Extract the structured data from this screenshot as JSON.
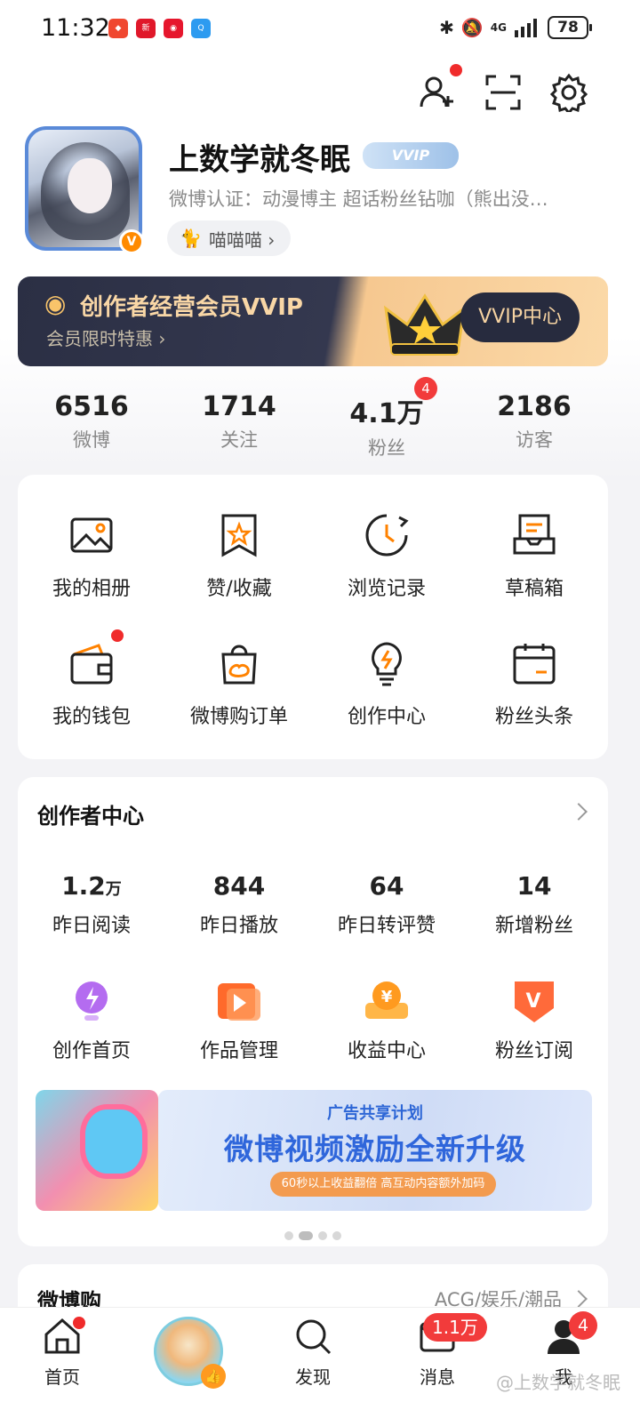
{
  "status_bar": {
    "time": "11:32",
    "network": "4G",
    "battery": "78",
    "app_icons": [
      "app-icon",
      "news-icon",
      "weibo-icon",
      "browser-icon"
    ]
  },
  "header_icons": [
    "add-friend-icon",
    "scan-icon",
    "settings-icon"
  ],
  "profile": {
    "name": "上数学就冬眠",
    "vip_tag": "VVIP",
    "verification": "微博认证：动漫博主 超话粉丝钻咖（熊出没…",
    "group_chip": "喵喵喵 ›"
  },
  "vvip_banner": {
    "title": "创作者经营会员VVIP",
    "subtitle": "会员限时特惠 ›",
    "button": "VVIP中心"
  },
  "stats": [
    {
      "num": "6516",
      "label": "微博"
    },
    {
      "num": "1714",
      "label": "关注"
    },
    {
      "num": "4.1万",
      "label": "粉丝",
      "badge": "4"
    },
    {
      "num": "2186",
      "label": "访客"
    }
  ],
  "grid": [
    {
      "label": "我的相册",
      "icon": "album-icon"
    },
    {
      "label": "赞/收藏",
      "icon": "favorite-icon"
    },
    {
      "label": "浏览记录",
      "icon": "history-icon"
    },
    {
      "label": "草稿箱",
      "icon": "draft-icon"
    },
    {
      "label": "我的钱包",
      "icon": "wallet-icon"
    },
    {
      "label": "微博购订单",
      "icon": "shopping-bag-icon"
    },
    {
      "label": "创作中心",
      "icon": "lightbulb-icon"
    },
    {
      "label": "粉丝头条",
      "icon": "calendar-icon"
    }
  ],
  "creator_center": {
    "title": "创作者中心",
    "stats": [
      {
        "num": "1.2",
        "unit": "万",
        "label": "昨日阅读"
      },
      {
        "num": "844",
        "unit": "",
        "label": "昨日播放"
      },
      {
        "num": "64",
        "unit": "",
        "label": "昨日转评赞"
      },
      {
        "num": "14",
        "unit": "",
        "label": "新增粉丝"
      }
    ],
    "tools": [
      {
        "label": "创作首页",
        "icon": "creation-home-icon"
      },
      {
        "label": "作品管理",
        "icon": "works-icon"
      },
      {
        "label": "收益中心",
        "icon": "income-icon"
      },
      {
        "label": "粉丝订阅",
        "icon": "subscribe-icon"
      }
    ],
    "ad": {
      "subtitle": "广告共享计划",
      "main": "微博视频激励全新升级",
      "pill": "60秒以上收益翻倍 高互动内容额外加码"
    }
  },
  "shop_section": {
    "title": "微博购",
    "categories": "ACG/娱乐/潮品"
  },
  "bottom_nav": {
    "home": "首页",
    "discover": "发现",
    "messages": "消息",
    "messages_badge": "1.1万",
    "me": "我",
    "me_badge": "4"
  },
  "watermark": "@上数学就冬眠",
  "colors": {
    "accent": "#ff8200",
    "badge_red": "#f23b3b",
    "link_blue": "#2f66db"
  }
}
